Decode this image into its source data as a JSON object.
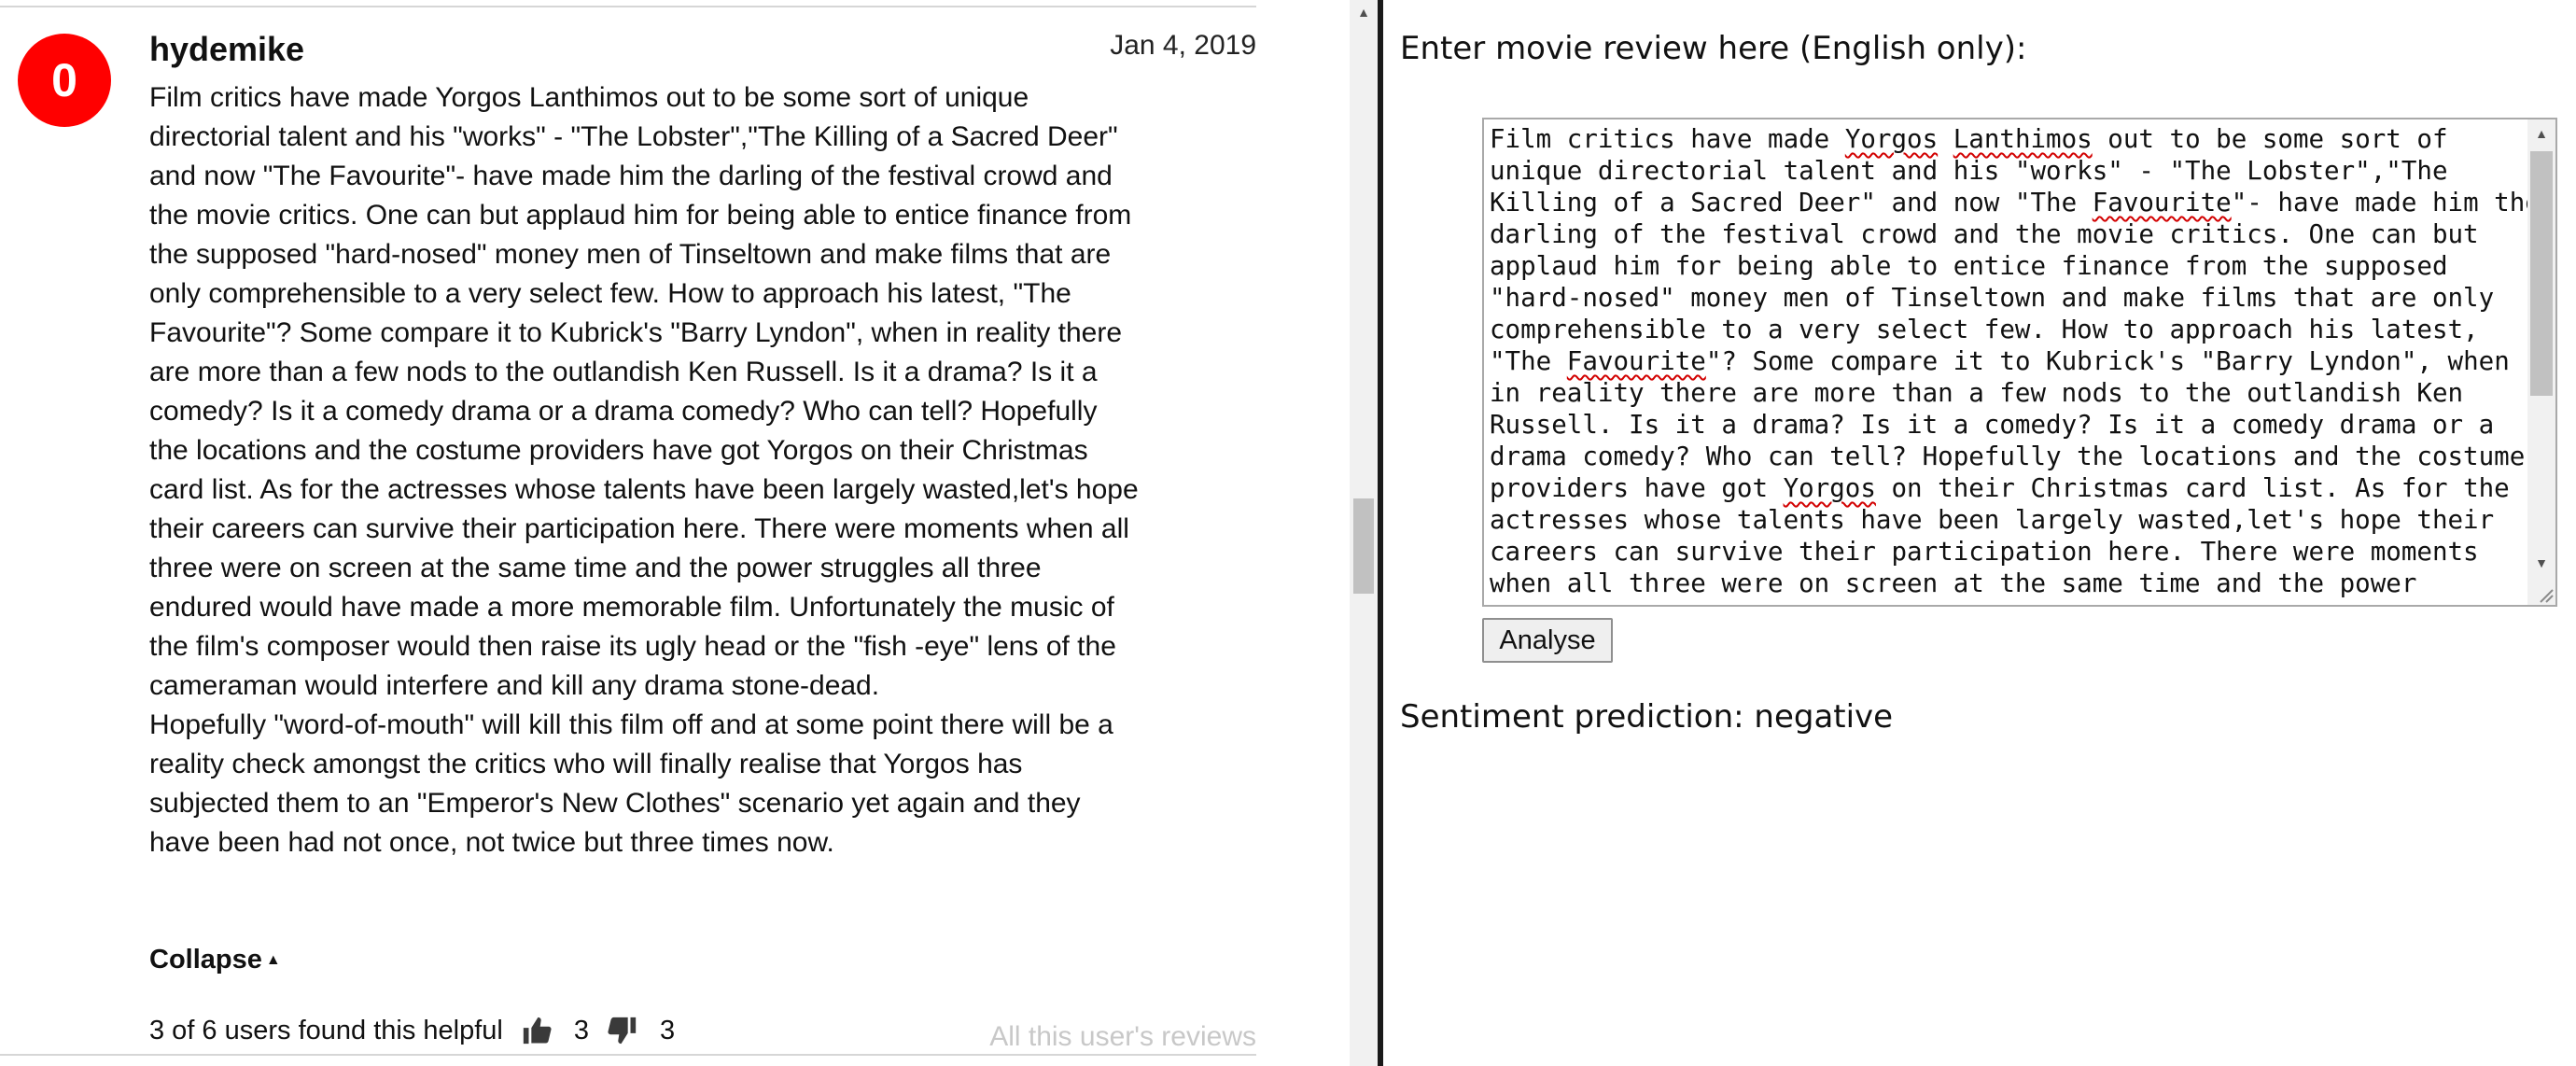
{
  "review": {
    "score": "0",
    "username": "hydemike",
    "date": "Jan 4, 2019",
    "paragraphs": [
      "Film critics have made Yorgos Lanthimos out to be some sort of unique directorial talent and his \"works\" - \"The Lobster\",\"The Killing of a Sacred Deer\" and now \"The Favourite\"- have made him the darling of the festival crowd and the movie critics. One can but applaud him for being able to entice finance from the supposed \"hard-nosed\" money men of Tinseltown and make films that are only comprehensible to a very select few. How to approach his latest, \"The Favourite\"? Some compare it to Kubrick's \"Barry Lyndon\", when in reality there are more than a few nods to the outlandish Ken Russell. Is it a drama? Is it a comedy? Is it a comedy drama or a drama comedy? Who can tell? Hopefully the locations and the costume providers have got Yorgos on their Christmas card list. As for the actresses whose talents have been largely wasted,let's hope their careers can survive their participation here. There were moments when all three were on screen at the same time and the power struggles all three endured would have made a more memorable film. Unfortunately the music of the film's composer would then raise its ugly head or the \"fish -eye\" lens of the cameraman would interfere and kill any drama stone-dead.",
      "Hopefully \"word-of-mouth\" will kill this film off and at some point there will be a reality check amongst the critics who will finally realise that Yorgos has subjected them to an \"Emperor's New Clothes\" scenario yet again and they have been had not once, not twice but three times now."
    ],
    "collapse_label": "Collapse",
    "helpful_text": "3 of 6 users found this helpful",
    "thumbs_up_count": "3",
    "thumbs_down_count": "3",
    "all_reviews_label": "All this user's reviews",
    "score_color": "#ff0000"
  },
  "analyzer": {
    "prompt": "Enter movie review here (English only):",
    "textarea_lines": [
      "Film critics have made Yorgos Lanthimos out to be some sort of",
      "unique directorial talent and his \"works\" - \"The Lobster\",\"The",
      "Killing of a Sacred Deer\" and now \"The Favourite\"- have made him the",
      "darling of the festival crowd and the movie critics. One can but",
      "applaud him for being able to entice finance from the supposed",
      "\"hard-nosed\" money men of Tinseltown and make films that are only",
      "comprehensible to a very select few. How to approach his latest,",
      "\"The Favourite\"? Some compare it to Kubrick's \"Barry Lyndon\", when",
      "in reality there are more than a few nods to the outlandish Ken",
      "Russell. Is it a drama? Is it a comedy? Is it a comedy drama or a",
      "drama comedy? Who can tell? Hopefully the locations and the costume",
      "providers have got Yorgos on their Christmas card list. As for the",
      "actresses whose talents have been largely wasted,let's hope their",
      "careers can survive their participation here. There were moments",
      "when all three were on screen at the same time and the power"
    ],
    "spellcheck_words": [
      "Yorgos",
      "Lanthimos",
      "Favourite"
    ],
    "analyse_label": "Analyse",
    "prediction_text": "Sentiment prediction: negative"
  },
  "icons": {
    "thumbs_up": "thumbs-up-icon",
    "thumbs_down": "thumbs-down-icon",
    "collapse_caret": "caret-up-icon"
  }
}
